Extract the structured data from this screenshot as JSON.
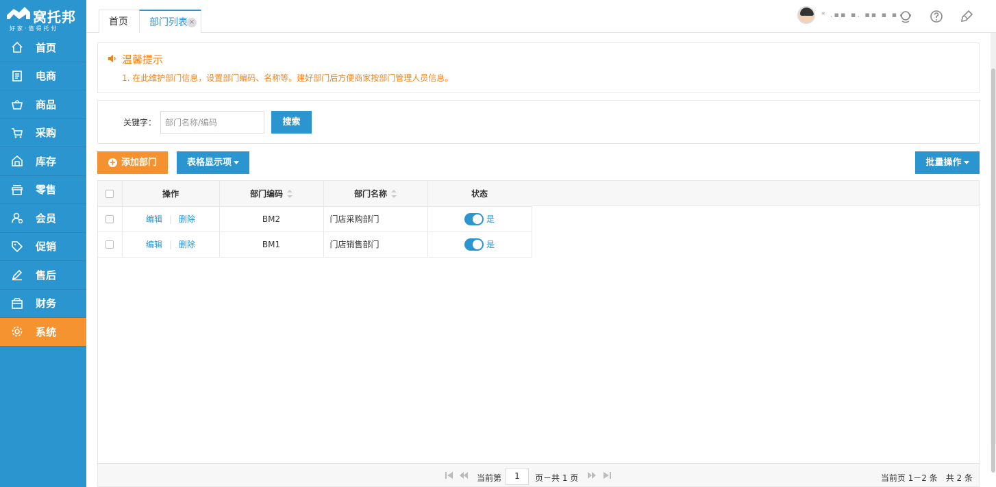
{
  "brand": {
    "name": "窝托邦",
    "slogan": "好家·值得托付"
  },
  "sidebar": {
    "items": [
      {
        "label": "首页",
        "icon": "home-icon"
      },
      {
        "label": "电商",
        "icon": "document-icon"
      },
      {
        "label": "商品",
        "icon": "basket-icon"
      },
      {
        "label": "采购",
        "icon": "cart-icon"
      },
      {
        "label": "库存",
        "icon": "warehouse-icon"
      },
      {
        "label": "零售",
        "icon": "store-icon"
      },
      {
        "label": "会员",
        "icon": "member-icon"
      },
      {
        "label": "促销",
        "icon": "tag-icon"
      },
      {
        "label": "售后",
        "icon": "pen-icon"
      },
      {
        "label": "财务",
        "icon": "wallet-icon"
      },
      {
        "label": "系统",
        "icon": "gear-icon",
        "active": true
      }
    ]
  },
  "tabs": [
    {
      "label": "首页"
    },
    {
      "label": "部门列表",
      "active": true,
      "close": "×"
    }
  ],
  "header": {
    "username": "* .▪▪ ▪. ▪▪ ▪ ▪"
  },
  "tips": {
    "title": "温馨提示",
    "text": "1. 在此维护部门信息，设置部门编码、名称等。建好部门后方便商家按部门管理人员信息。"
  },
  "search": {
    "label": "关键字：",
    "placeholder": "部门名称/编码",
    "button": "搜索"
  },
  "toolbar": {
    "add_label": "添加部门",
    "columns_label": "表格显示项",
    "batch_label": "批量操作"
  },
  "table": {
    "headers": {
      "action": "操作",
      "code": "部门编码",
      "name": "部门名称",
      "status": "状态"
    },
    "rows": [
      {
        "edit": "编辑",
        "delete": "删除",
        "code": "BM2",
        "name": "门店采购部门",
        "status": "是"
      },
      {
        "edit": "编辑",
        "delete": "删除",
        "code": "BM1",
        "name": "门店销售部门",
        "status": "是"
      }
    ]
  },
  "pager": {
    "prefix": "当前第",
    "page": "1",
    "suffix": "页－共 1 页",
    "summary": "当前页 1－2 条　共 2 条"
  },
  "colors": {
    "primary": "#2a95cf",
    "accent": "#f5922f",
    "tip": "#f08519"
  }
}
